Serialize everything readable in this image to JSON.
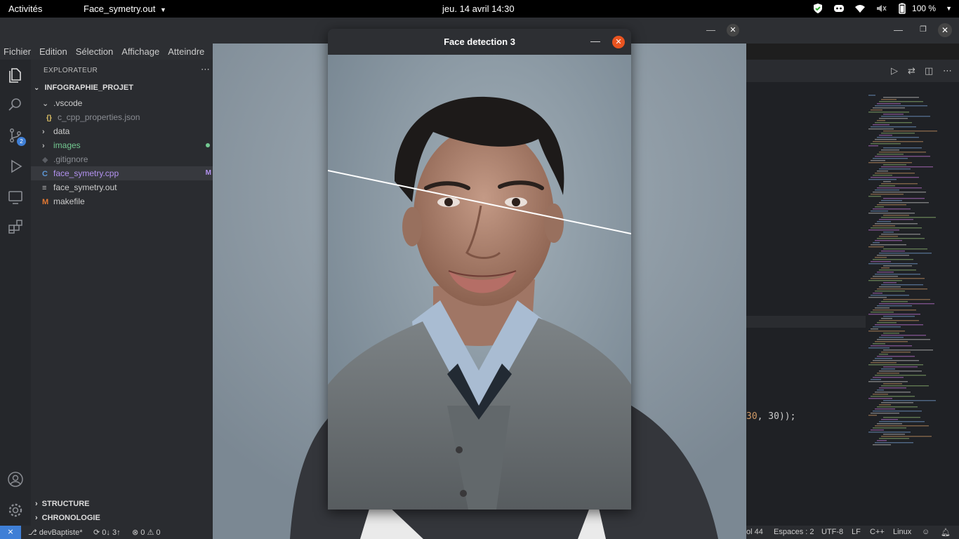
{
  "topbar": {
    "activities": "Activités",
    "app_menu": "Face_symetry.out",
    "clock": "jeu. 14 avril  14:30",
    "battery": "100 %"
  },
  "vscode": {
    "menu": [
      "Fichier",
      "Edition",
      "Sélection",
      "Affichage",
      "Atteindre"
    ],
    "explorer_title": "EXPLORATEUR",
    "project": "INFOGRAPHIE_PROJET",
    "tree": [
      {
        "label": ".vscode",
        "type": "folder-open",
        "indent": 1,
        "color": "#cccccc"
      },
      {
        "label": "c_cpp_properties.json",
        "type": "json",
        "indent": 2,
        "color": "#8a8d93"
      },
      {
        "label": "data",
        "type": "folder",
        "indent": 1,
        "color": "#cccccc"
      },
      {
        "label": "images",
        "type": "folder",
        "indent": 1,
        "color": "#73c991"
      },
      {
        "label": ".gitignore",
        "type": "git",
        "indent": 1,
        "color": "#8a8d93"
      },
      {
        "label": "face_symetry.cpp",
        "type": "cpp",
        "indent": 1,
        "color": "#b392f0",
        "badge": "M",
        "selected": true
      },
      {
        "label": "face_symetry.out",
        "type": "file",
        "indent": 1,
        "color": "#cccccc"
      },
      {
        "label": "makefile",
        "type": "makefile",
        "indent": 1,
        "color": "#cccccc"
      }
    ],
    "sections": [
      "STRUCTURE",
      "CHRONOLOGIE"
    ],
    "scm_badge": "2",
    "code_fragment": {
      "num": "30",
      "rest": ", 30));"
    },
    "status": {
      "branch": "devBaptiste*",
      "sync": "0↓ 3↑",
      "problems": "⊗ 0 ⚠ 0",
      "col": "ol 44",
      "spaces": "Espaces : 2",
      "encoding": "UTF-8",
      "eol": "LF",
      "lang": "C++",
      "os": "Linux"
    }
  },
  "viewer": {
    "title": "Face detection 3"
  },
  "colors": {
    "accent_close": "#e95420",
    "vscode_blue": "#3f7fd6",
    "photo_bg": "#8e9ba5"
  }
}
